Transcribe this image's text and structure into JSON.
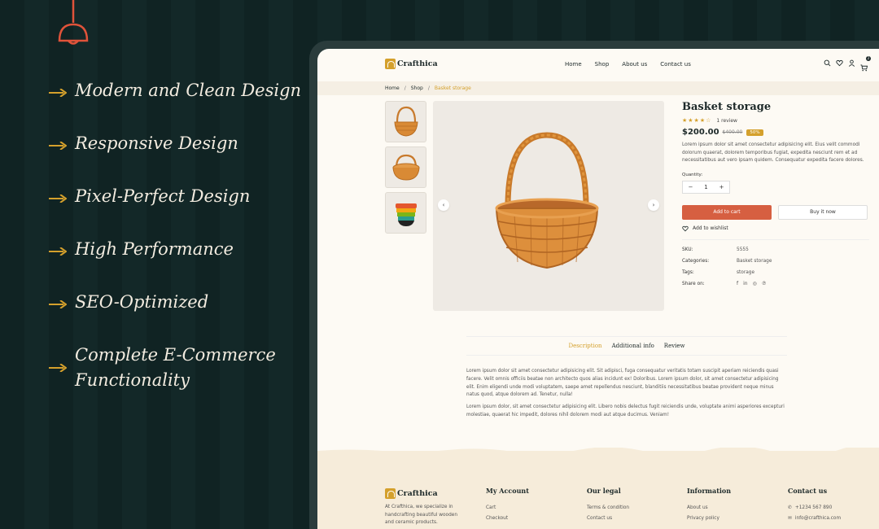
{
  "features": [
    "Modern and Clean Design",
    "Responsive Design",
    "Pixel-Perfect Design",
    "High Performance",
    "SEO-Optimized",
    "Complete E-Commerce Functionality"
  ],
  "colors": {
    "bg": "#0f2121",
    "accent": "#d4a02c",
    "lamp": "#e0533a",
    "cta": "#d65f41",
    "page_bg": "#fdfaf4",
    "footer_bg": "#f6ecda"
  },
  "site": {
    "logo": "Crafthica",
    "menu": [
      "Home",
      "Shop",
      "About us",
      "Contact us"
    ],
    "icons": [
      "search-icon",
      "heart-icon",
      "user-icon",
      "cart-icon"
    ],
    "cart_count": "2"
  },
  "breadcrumb": [
    "Home",
    "Shop",
    "Basket storage"
  ],
  "product": {
    "title": "Basket storage",
    "stars": "★★★★☆",
    "reviews": "1 review",
    "price": "$200.00",
    "old_price": "$400.00",
    "discount": "50%",
    "description": "Lorem ipsum dolor sit amet consectetur adipisicing elit. Eius velit commodi dolorum quaerat, dolorem temporibus fugiat, expedita nesciunt rem et ad necessitatibus aut vero ipsam quidem. Consequatur expedita facere dolores.",
    "quantity_label": "Quantity:",
    "quantity": "1",
    "minus": "−",
    "plus": "+",
    "add_to_cart": "Add to cart",
    "buy_now": "Buy it now",
    "wishlist": "Add to wishlist",
    "meta": [
      {
        "k": "SKU:",
        "v": "5555"
      },
      {
        "k": "Categories:",
        "v": "Basket storage"
      },
      {
        "k": "Tags:",
        "v": "storage"
      }
    ],
    "share_label": "Share on:",
    "share_icons": [
      "facebook-icon",
      "linkedin-icon",
      "dribbble-icon",
      "pinterest-icon"
    ]
  },
  "tabs": [
    "Description",
    "Additional info",
    "Review"
  ],
  "tab_content": [
    "Lorem ipsum dolor sit amet consectetur adipisicing elit. Sit adipisci, fuga consequatur veritatis totam suscipit aperiam reiciendis quasi facere. Velit omnis officiis beatae non architecto quos alias incidunt ex! Doloribus. Lorem ipsum dolor, sit amet consectetur adipisicing elit. Enim eligendi unde modi voluptatem, saepe amet repellendus nesciunt, blanditiis necessitatibus beatae provident neque minus natus quod, atque dolorem ad. Tenetur, nulla!",
    "Lorem ipsum dolor, sit amet consectetur adipisicing elit. Libero nobis delectus fugit reiciendis unde, voluptate animi asperiores excepturi molestiae, quaerat hic impedit, dolores nihil dolorem modi aut atque ducimus. Veniam!"
  ],
  "footer": {
    "logo": "Crafthica",
    "about": "At Crafthica, we specialize in handcrafting beautiful wooden and ceramic products.",
    "my_account": {
      "title": "My Account",
      "links": [
        "Cart",
        "Checkout"
      ]
    },
    "our_legal": {
      "title": "Our legal",
      "links": [
        "Terms & condition",
        "Contact us"
      ]
    },
    "information": {
      "title": "Information",
      "links": [
        "About us",
        "Privacy policy"
      ]
    },
    "contact": {
      "title": "Contact us",
      "phone": "+1234 567 890",
      "email": "info@crafthica.com"
    }
  }
}
